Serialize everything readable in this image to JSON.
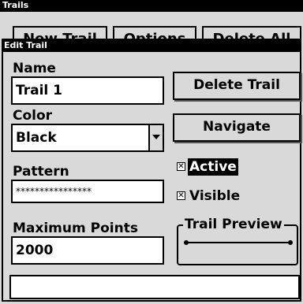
{
  "trails_window": {
    "title": "Trails",
    "buttons": [
      "New Trail",
      "Options",
      "Delete All"
    ]
  },
  "dialog": {
    "title": "Edit Trail",
    "name_label": "Name",
    "name_value": "Trail 1",
    "color_label": "Color",
    "color_value": "Black",
    "pattern_label": "Pattern",
    "pattern_value": "****************",
    "max_points_label": "Maximum Points",
    "max_points_value": "2000",
    "delete_button": "Delete Trail",
    "navigate_button": "Navigate",
    "active_label": "Active",
    "active_checked": true,
    "visible_label": "Visible",
    "visible_checked": true,
    "preview_label": "Trail Preview",
    "status_text": ""
  },
  "colors": {
    "background": "#d9d9d9",
    "field": "#ffffff",
    "border": "#000000",
    "highlight": "#000000"
  }
}
